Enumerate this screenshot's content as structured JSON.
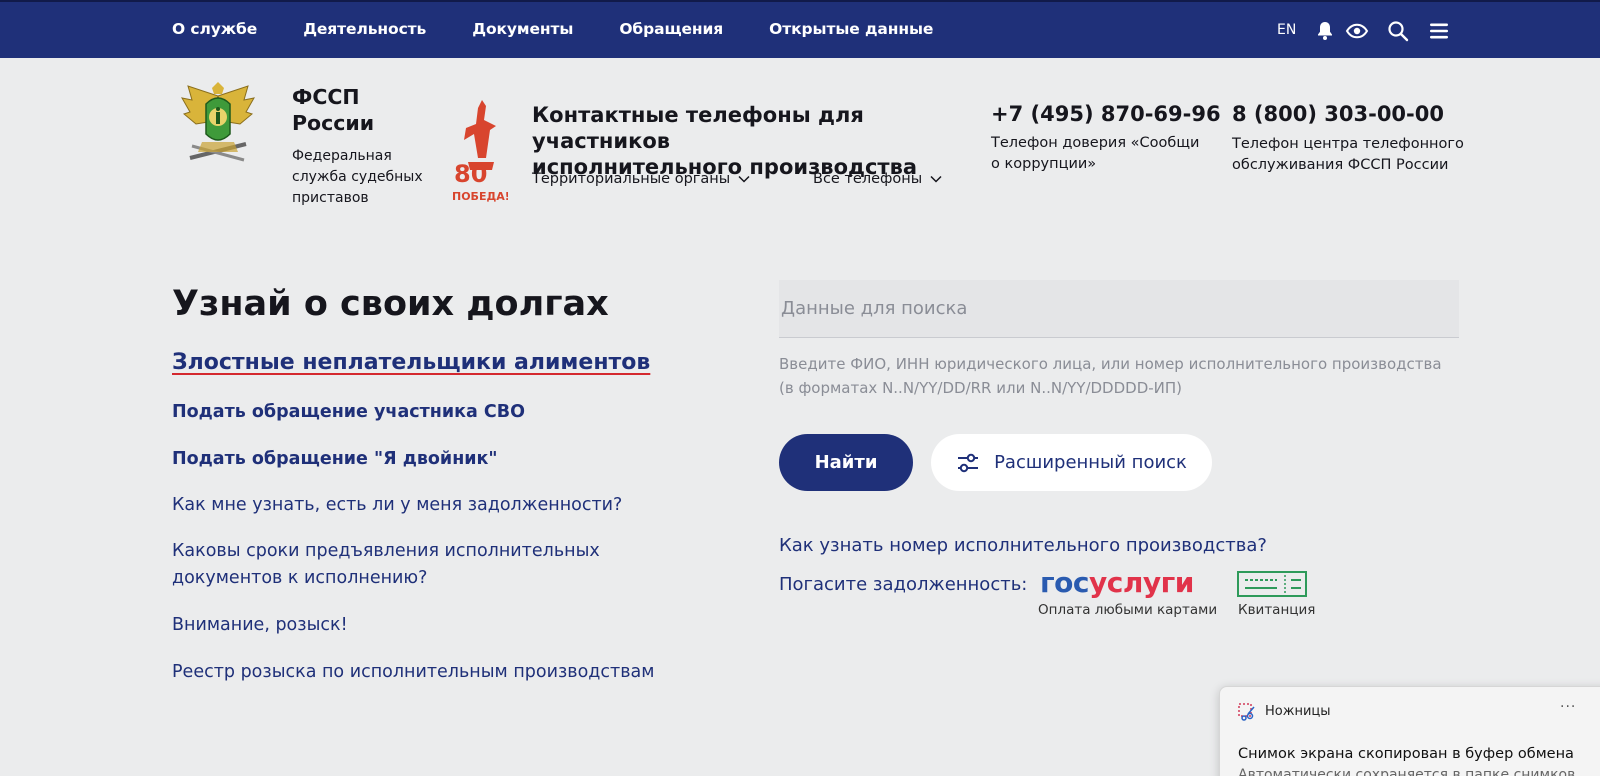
{
  "nav": {
    "items": [
      "О службе",
      "Деятельность",
      "Документы",
      "Обращения",
      "Открытые данные"
    ],
    "lang": "EN"
  },
  "org": {
    "name_line1": "ФССП",
    "name_line2": "России",
    "desc_line1": "Федеральная",
    "desc_line2": "служба судебных",
    "desc_line3": "приставов",
    "badge_number": "80",
    "badge_text": "ПОБЕДА!"
  },
  "contacts": {
    "title_line1": "Контактные телефоны для участников",
    "title_line2": "исполнительного производства",
    "territorial": "Территориальные органы",
    "all_phones": "Все телефоны",
    "phone1": "+7 (495) 870-69-96",
    "phone1_desc_line1": "Телефон доверия «Сообщи",
    "phone1_desc_line2": "о коррупции»",
    "phone2": "8 (800) 303-00-00",
    "phone2_desc_line1": "Телефон центра телефонного",
    "phone2_desc_line2": "обслуживания ФССП России"
  },
  "hero": {
    "title": "Узнай о своих долгах",
    "main_link": "Злостные неплательщики алиментов",
    "links": [
      "Подать обращение участника СВО",
      "Подать обращение \"Я двойник\"",
      "Как мне узнать, есть ли у меня задолженности?",
      "Каковы сроки предъявления исполнительных",
      "документов к исполнению?",
      "Внимание, розыск!",
      "Реестр розыска по исполнительным производствам"
    ]
  },
  "search": {
    "placeholder": "Данные для поиска",
    "value": "",
    "hint_line1": "Введите ФИО, ИНН юридического лица, или номер исполнительного производства",
    "hint_line2": "(в форматах N..N/YY/DD/RR или N..N/YY/DDDDD-ИП)",
    "find_button": "Найти",
    "advanced_button": "Расширенный поиск",
    "howto_link": "Как узнать номер исполнительного производства?",
    "pay_label": "Погасите задолженность:",
    "gos_logo_part1": "гос",
    "gos_logo_part2": "услуги",
    "gos_caption": "Оплата любыми картами",
    "receipt_caption": "Квитанция"
  },
  "toast": {
    "app": "Ножницы",
    "dots": "···",
    "message": "Снимок экрана скопирован в буфер обмена",
    "sub": "Автоматически сохраняется в папке снимков"
  },
  "colors": {
    "brand_blue": "#1f3079",
    "accent_red": "#d4282e",
    "background": "#ebeced"
  }
}
